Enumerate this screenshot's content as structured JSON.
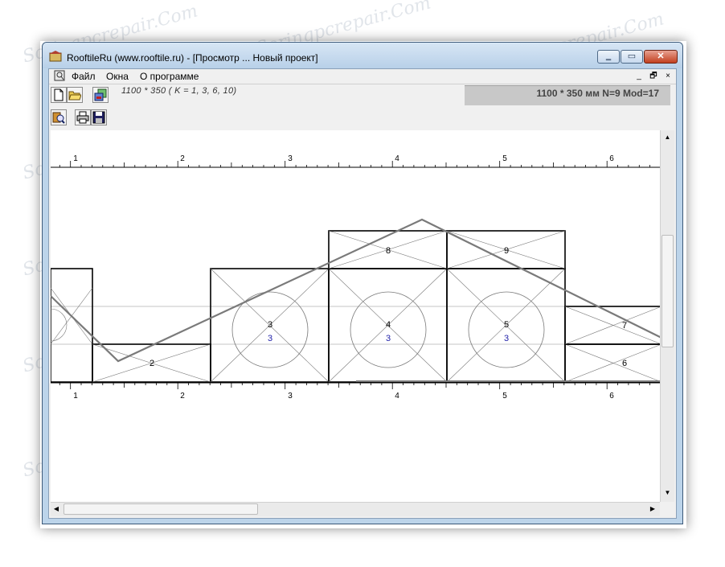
{
  "window": {
    "title": "RooftileRu (www.rooftile.ru) - [Просмотр ... Новый проект]",
    "minimize_label": "‗",
    "maximize_label": "▭",
    "close_label": "✕"
  },
  "menu": {
    "items": [
      "Файл",
      "Окна",
      "О программе"
    ],
    "mdi_min": "_",
    "mdi_restore": "🗗",
    "mdi_close": "×"
  },
  "toolbar": {
    "size_label": "1100 * 350  ( K = 1, 3, 6, 10)",
    "status": "1100 * 350 мм N=9 Mod=17"
  },
  "ruler": {
    "top_labels": [
      "1",
      "2",
      "3",
      "4",
      "5",
      "6"
    ],
    "bottom_labels": [
      "1",
      "2",
      "3",
      "4",
      "5",
      "6"
    ]
  },
  "tiles": {
    "labels": [
      "2",
      "3",
      "4",
      "5",
      "6",
      "7",
      "8",
      "9"
    ],
    "circle_counts": [
      "3",
      "3",
      "3"
    ]
  },
  "watermark": "Soringpcrepair.Com",
  "colors": {
    "accent_blue": "#1f1fa8",
    "roof_line": "#7a7a7a",
    "status_bg": "#c8c8c8"
  }
}
